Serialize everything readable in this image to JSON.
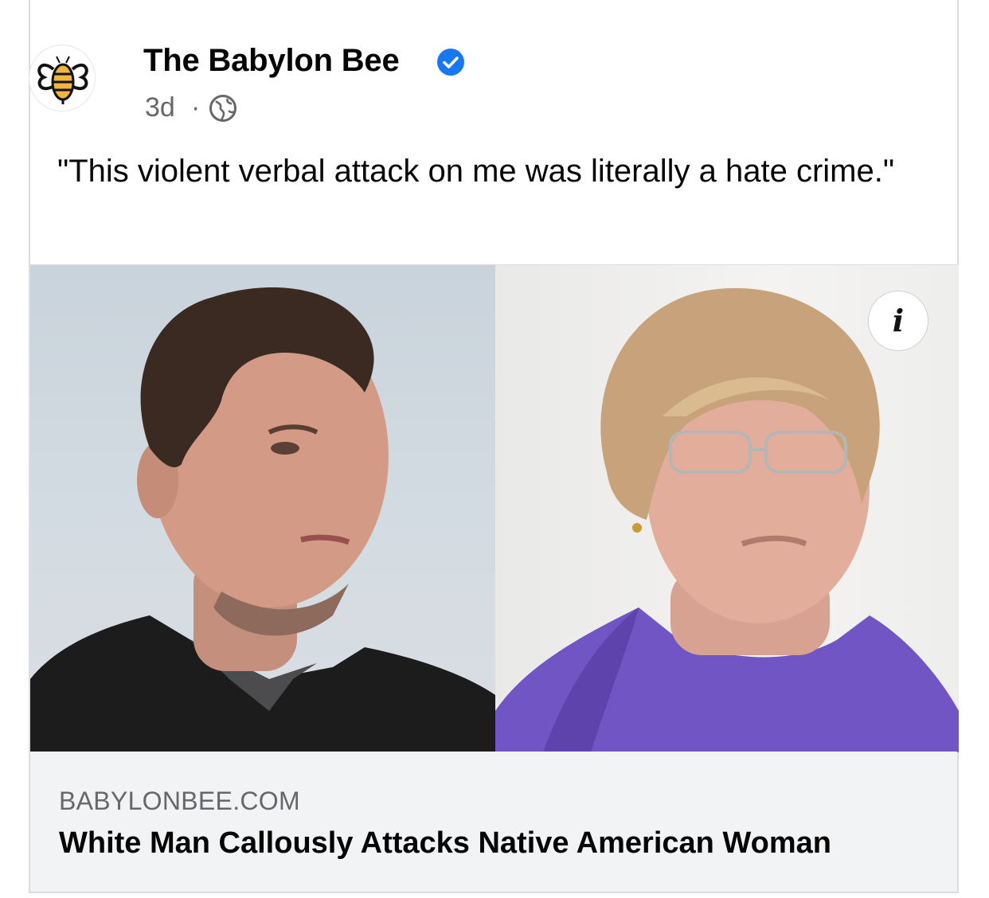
{
  "post": {
    "page_name": "The Babylon Bee",
    "timestamp": "3d",
    "separator": "·",
    "audience_icon": "globe-icon",
    "verified_icon": "verified-badge-icon",
    "caption": "\"This violent verbal attack on me was literally a hate crime.\""
  },
  "link": {
    "domain": "BABYLONBEE.COM",
    "headline": "White Man Callously Attacks Native American Woman",
    "info_label": "i"
  },
  "colors": {
    "verified": "#1877f2",
    "secondary_text": "#65676b",
    "preview_bg": "#f2f3f5",
    "bee_yellow": "#f0b63c"
  }
}
